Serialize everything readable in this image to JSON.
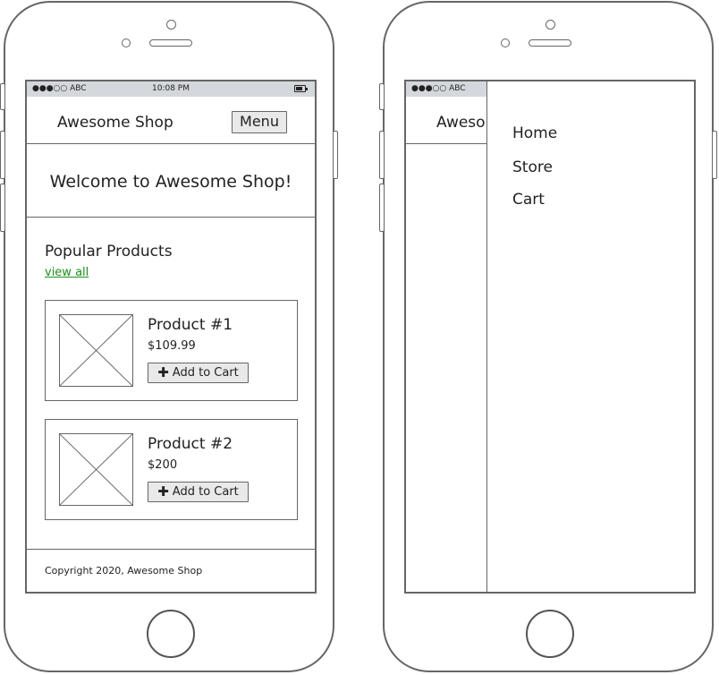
{
  "status_bar": {
    "carrier": "●●●○○ ABC",
    "time": "10:08 PM"
  },
  "header": {
    "brand": "Awesome Shop",
    "menu_label": "Menu"
  },
  "hero": {
    "welcome": "Welcome to Awesome Shop!"
  },
  "popular": {
    "title": "Popular Products",
    "view_all": "view all",
    "link_color": "#1d8f1d",
    "products": [
      {
        "name": "Product #1",
        "price": "$109.99",
        "add_label": "Add to Cart"
      },
      {
        "name": "Product #2",
        "price": "$200",
        "add_label": "Add to Cart"
      }
    ]
  },
  "footer": {
    "copyright": "Copyright 2020, Awesome Shop"
  },
  "right_phone": {
    "status_bar": {
      "carrier": "●●●○○ ABC"
    },
    "brand_partial": "Awesome",
    "drawer_items": [
      "Home",
      "Store",
      "Cart"
    ]
  },
  "icons": {
    "add": "plus-icon",
    "battery": "battery-icon",
    "image": "image-placeholder-icon"
  }
}
